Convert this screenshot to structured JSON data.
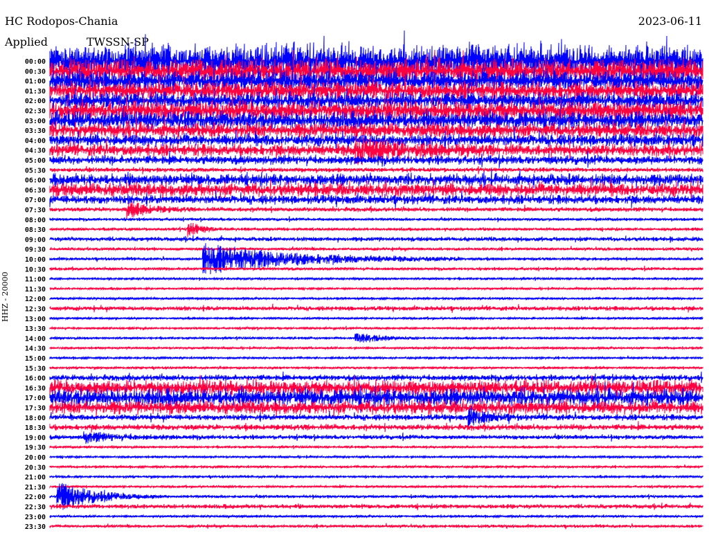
{
  "header": {
    "station": "HC Rodopos-Chania",
    "date": "2023-06-11",
    "applied": "Applied",
    "filter": "TWSSN-SP",
    "scale_label": "HHZ - 20000"
  },
  "chart_data": {
    "type": "line",
    "title": "HC Rodopos-Chania",
    "ylabel": "HHZ - 20000",
    "colors": [
      "#0000ff",
      "#ff0040"
    ],
    "row_labels": [
      "00:00",
      "00:30",
      "01:00",
      "01:30",
      "02:00",
      "02:30",
      "03:00",
      "03:30",
      "04:00",
      "04:30",
      "05:00",
      "05:30",
      "06:00",
      "06:30",
      "07:00",
      "07:30",
      "08:00",
      "08:30",
      "09:00",
      "09:30",
      "10:00",
      "10:30",
      "11:00",
      "11:30",
      "12:00",
      "12:30",
      "13:00",
      "13:30",
      "14:00",
      "14:30",
      "15:00",
      "15:30",
      "16:00",
      "16:30",
      "17:00",
      "17:30",
      "18:00",
      "18:30",
      "19:00",
      "19:30",
      "20:00",
      "20:30",
      "21:00",
      "21:30",
      "22:00",
      "22:30",
      "23:00",
      "23:30"
    ],
    "noise_amplitude": [
      22,
      16,
      14,
      12,
      11,
      13,
      12,
      10,
      8,
      8,
      6,
      3,
      8,
      9,
      6,
      3,
      2,
      2,
      3,
      2,
      2,
      2,
      1.5,
      1.5,
      1.5,
      3,
      1.5,
      1.5,
      1.5,
      1.5,
      1.5,
      1.5,
      4,
      10,
      12,
      9,
      4,
      4,
      3,
      1.5,
      1.5,
      1.5,
      1.5,
      1.5,
      2,
      3,
      1.5,
      2
    ],
    "events": [
      {
        "row": 9,
        "minute": 14,
        "amplitude": 16,
        "duration": 2
      },
      {
        "row": 15,
        "minute": 3.5,
        "amplitude": 12,
        "duration": 1
      },
      {
        "row": 17,
        "minute": 6.3,
        "amplitude": 12,
        "duration": 0.6
      },
      {
        "row": 20,
        "minute": 7.0,
        "amplitude": 22,
        "duration": 4
      },
      {
        "row": 28,
        "minute": 14.0,
        "amplitude": 8,
        "duration": 1.2
      },
      {
        "row": 36,
        "minute": 19.2,
        "amplitude": 14,
        "duration": 0.8
      },
      {
        "row": 44,
        "minute": 0.3,
        "amplitude": 22,
        "duration": 1.6
      },
      {
        "row": 38,
        "minute": 1.5,
        "amplitude": 7,
        "duration": 1.5
      }
    ]
  }
}
